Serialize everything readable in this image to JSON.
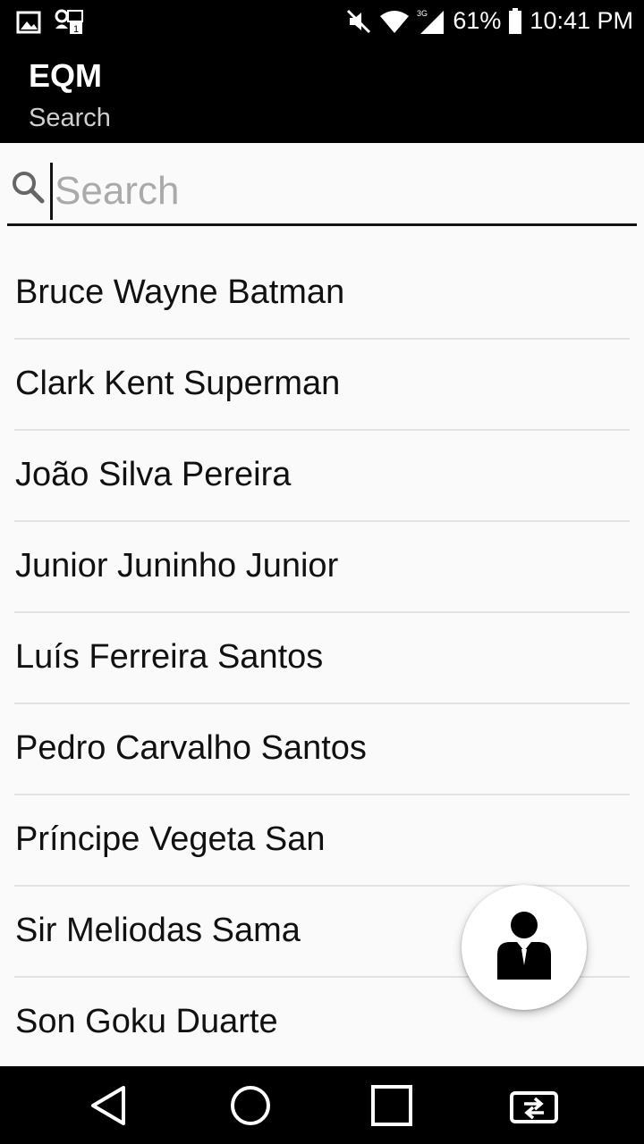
{
  "status_bar": {
    "battery_percent": "61%",
    "time": "10:41 PM",
    "network_type": "3G",
    "icons": [
      "image-icon",
      "notification-icon",
      "mute-icon",
      "wifi-icon",
      "signal-icon",
      "battery-icon"
    ]
  },
  "app_bar": {
    "title": "EQM",
    "subtitle": "Search"
  },
  "search": {
    "placeholder": "Search",
    "value": ""
  },
  "list": {
    "items": [
      "Bruce Wayne Batman",
      "Clark Kent Superman",
      "João Silva Pereira",
      "Junior Juninho Junior",
      "Luís Ferreira Santos",
      "Pedro Carvalho Santos",
      "Príncipe Vegeta San",
      "Sir Meliodas Sama",
      "Son Goku Duarte"
    ]
  },
  "fab": {
    "icon": "person-tie-icon"
  },
  "nav_bar": {
    "icons": [
      "back-icon",
      "home-icon",
      "recents-icon",
      "switch-app-icon"
    ]
  },
  "colors": {
    "app_bar_bg": "#000000",
    "page_bg": "#fafafa",
    "divider": "#e2e2e2"
  }
}
